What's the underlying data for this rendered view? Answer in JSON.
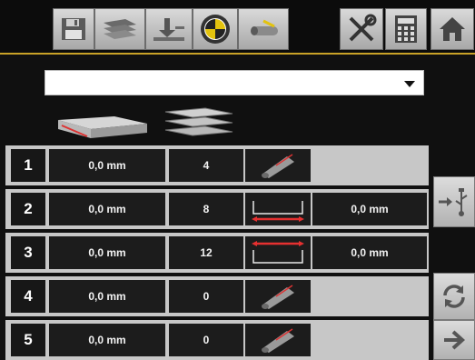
{
  "toolbar": {
    "buttons": [
      {
        "icon": "save-icon"
      },
      {
        "icon": "sheet-stack-icon"
      },
      {
        "icon": "press-icon"
      },
      {
        "icon": "target-icon"
      },
      {
        "icon": "pipe-cut-icon"
      },
      {
        "icon": "tools-icon"
      },
      {
        "icon": "calculator-icon"
      },
      {
        "icon": "home-icon"
      }
    ],
    "accent_color": "#c9a227"
  },
  "dropdown": {
    "value": ""
  },
  "header_icons": [
    "single-profile-icon",
    "stacked-profiles-icon"
  ],
  "rows": [
    {
      "index": "1",
      "length": "0,0 mm",
      "count": "4",
      "icon": "rod-icon",
      "extra": ""
    },
    {
      "index": "2",
      "length": "0,0 mm",
      "count": "8",
      "icon": "channel-bottom-icon",
      "extra": "0,0 mm"
    },
    {
      "index": "3",
      "length": "0,0 mm",
      "count": "12",
      "icon": "channel-top-icon",
      "extra": "0,0 mm"
    },
    {
      "index": "4",
      "length": "0,0 mm",
      "count": "0",
      "icon": "rod-icon",
      "extra": ""
    },
    {
      "index": "5",
      "length": "0,0 mm",
      "count": "0",
      "icon": "rod-icon",
      "extra": ""
    }
  ],
  "side_buttons": [
    "usb-export-icon",
    "refresh-icon",
    "next-arrow-icon"
  ]
}
